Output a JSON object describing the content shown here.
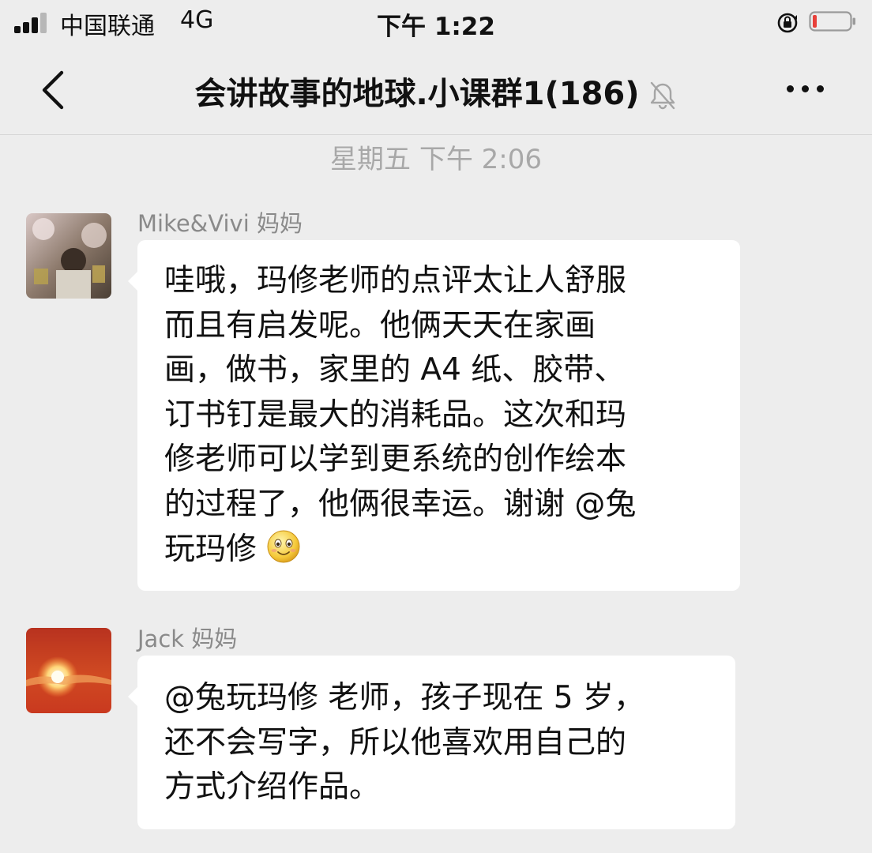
{
  "status_bar": {
    "carrier": "中国联通",
    "network": "4G",
    "time": "下午 1:22"
  },
  "nav": {
    "title": "会讲故事的地球.小课群1(186)"
  },
  "timestamp": "星期五 下午 2:06",
  "messages": [
    {
      "sender": "Mike&Vivi 妈妈",
      "lines": [
        "哇哦，玛修老师的点评太让人舒服",
        "而且有启发呢。他俩天天在家画",
        "画，做书，家里的 A4 纸、胶带、",
        "订书钉是最大的消耗品。这次和玛",
        "修老师可以学到更系统的创作绘本",
        "的过程了，他俩很幸运。谢谢 @兔",
        "玩玛修"
      ],
      "emoji": "smile-emoji"
    },
    {
      "sender": "Jack 妈妈",
      "lines": [
        "@兔玩玛修 老师，孩子现在 5 岁，",
        "还不会写字，所以他喜欢用自己的",
        "方式介绍作品。"
      ]
    }
  ],
  "colors": {
    "background": "#ededed",
    "bubble": "#ffffff",
    "battery_low": "#e8403a",
    "timestamp": "#a8a8a8",
    "sender_name": "#8a8a8a"
  },
  "battery_level": 0.1
}
